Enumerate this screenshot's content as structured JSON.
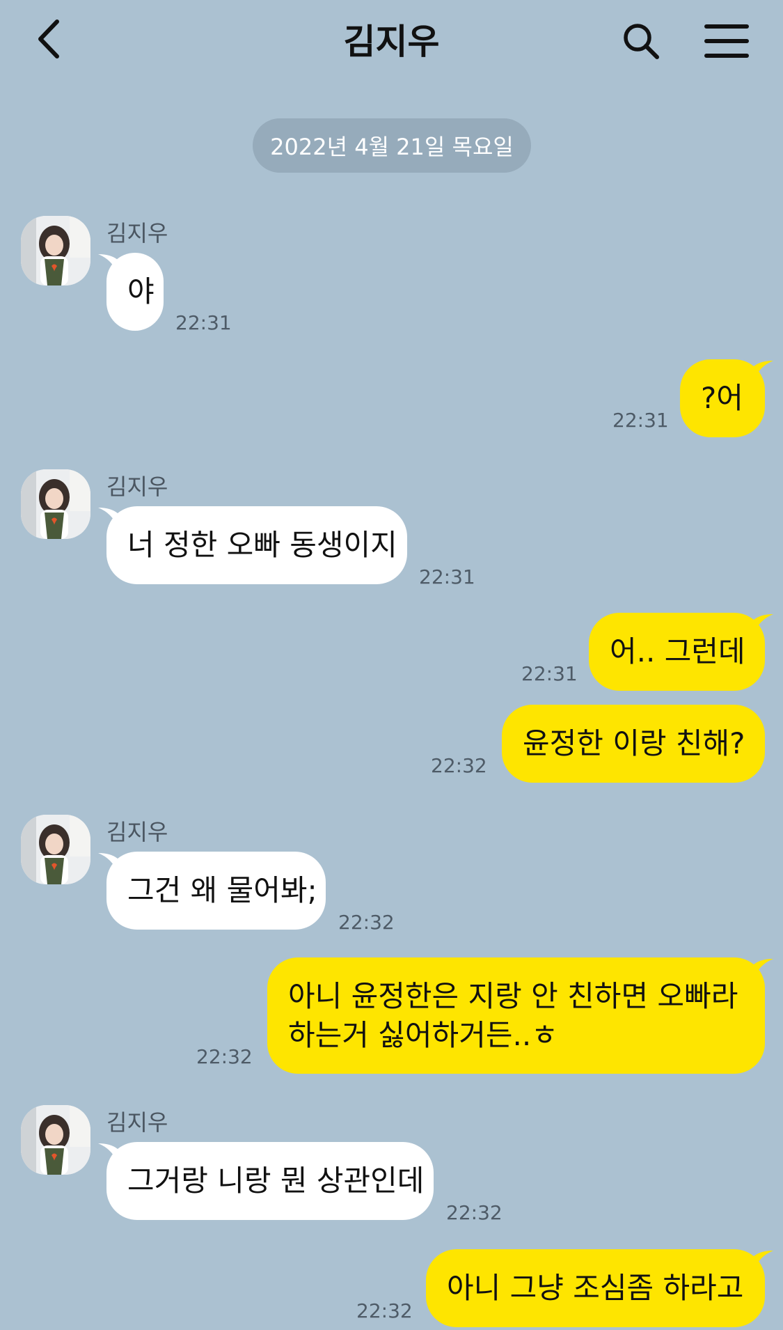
{
  "header": {
    "title": "김지우",
    "back_icon": "chevron-left-icon",
    "search_icon": "search-icon",
    "menu_icon": "hamburger-menu-icon"
  },
  "date_divider": "2022년 4월 21일 목요일",
  "colors": {
    "background": "#abc1d1",
    "incoming_bubble": "#ffffff",
    "outgoing_bubble": "#fee500",
    "date_pill": "#96abbb"
  },
  "messages": [
    {
      "direction": "in",
      "sender": "김지우",
      "text": "야",
      "time": "22:31"
    },
    {
      "direction": "out",
      "text": "?어",
      "time": "22:31"
    },
    {
      "direction": "in",
      "sender": "김지우",
      "text": "너 정한 오빠 동생이지",
      "time": "22:31"
    },
    {
      "direction": "out",
      "text": "어.. 그런데",
      "time": "22:31"
    },
    {
      "direction": "out",
      "text": "윤정한 이랑 친해?",
      "time": "22:32"
    },
    {
      "direction": "in",
      "sender": "김지우",
      "text": "그건 왜 물어봐;",
      "time": "22:32"
    },
    {
      "direction": "out",
      "text": "아니 윤정한은 지랑 안 친하면 오빠라 하는거 싫어하거든..ㅎ",
      "time": "22:32"
    },
    {
      "direction": "in",
      "sender": "김지우",
      "text": "그거랑 니랑 뭔 상관인데",
      "time": "22:32"
    },
    {
      "direction": "out",
      "text": "아니 그냥 조심좀 하라고",
      "time": "22:32"
    }
  ]
}
